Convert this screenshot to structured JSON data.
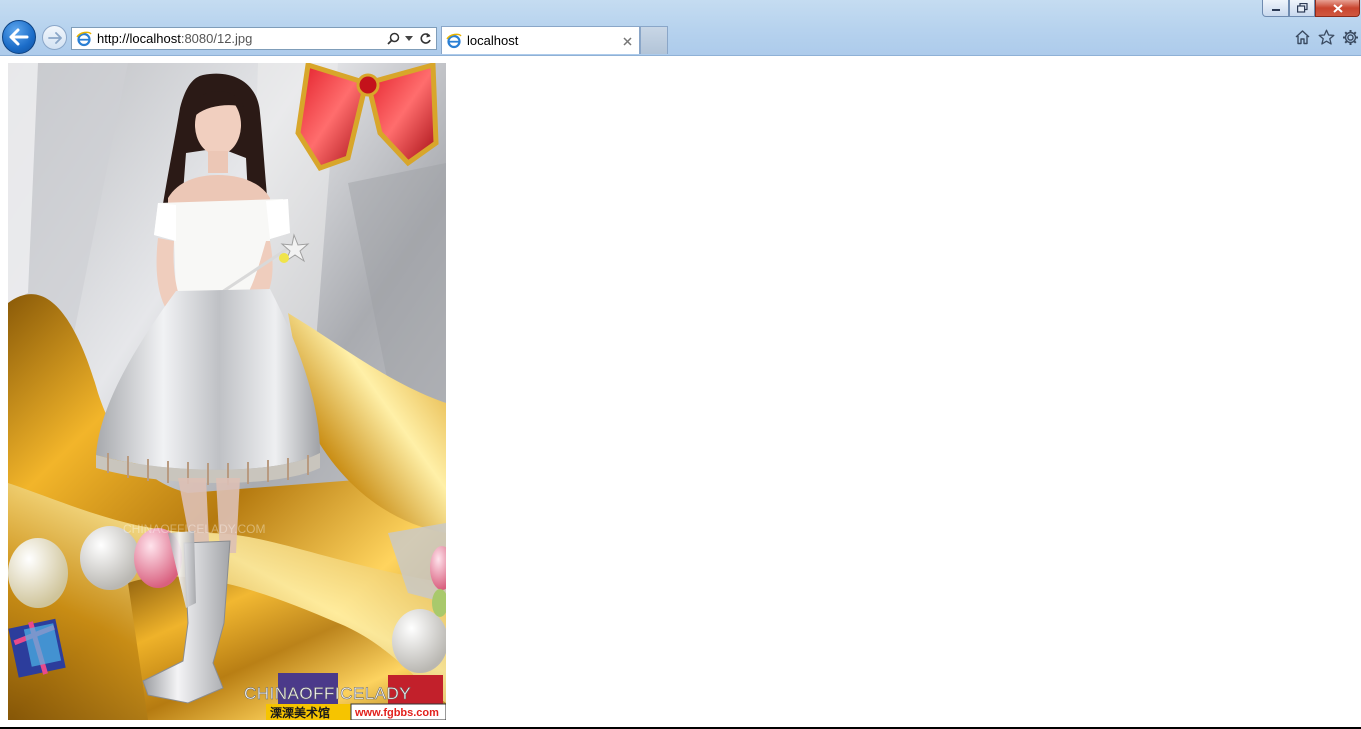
{
  "window": {
    "controls": {
      "minimize": "minimize",
      "restore": "restore",
      "close": "close"
    }
  },
  "navigation": {
    "back_icon": "back-arrow-icon",
    "forward_icon": "forward-arrow-icon"
  },
  "address_bar": {
    "url_host": "http://localhost",
    "url_rest": ":8080/12.jpg",
    "search_icon": "search-icon",
    "dropdown_icon": "dropdown-icon",
    "refresh_icon": "refresh-icon"
  },
  "tabs": [
    {
      "label": "localhost",
      "active": true
    }
  ],
  "toolbar": {
    "home_icon": "home-icon",
    "favorites_icon": "star-icon",
    "settings_icon": "gear-icon"
  },
  "image": {
    "watermark_brand": "CHINAOFFICELADY",
    "watermark_site_cn": "溧溧美术馆",
    "watermark_url": "www.fgbbs.com"
  },
  "colors": {
    "chrome": "#b6d2ee",
    "back_button": "#1b6cc8",
    "close_button": "#c9452f",
    "watermark_red": "#e2211c",
    "watermark_yellow": "#f6c400"
  }
}
